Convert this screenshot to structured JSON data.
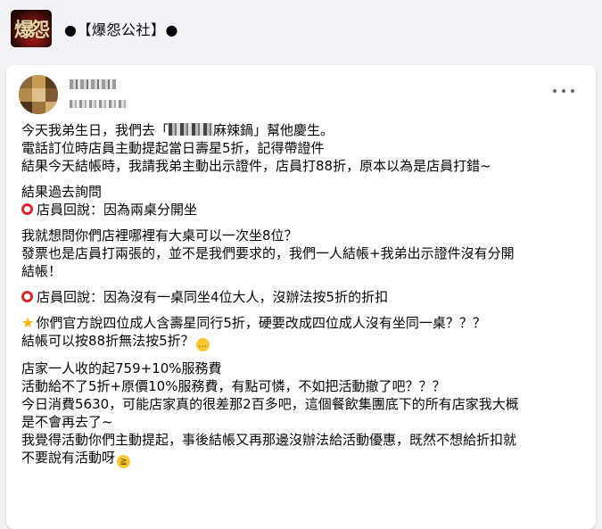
{
  "group": {
    "name": "●【爆怨公社】●",
    "logo_glyph": "爆怨"
  },
  "post": {
    "paragraphs": [
      {
        "lines": [
          {
            "segments": [
              {
                "type": "text",
                "value": "今天我弟生日，我們去「"
              },
              {
                "type": "censor"
              },
              {
                "type": "text",
                "value": "麻辣鍋」幫他慶生。"
              }
            ]
          },
          {
            "segments": [
              {
                "type": "text",
                "value": "電話訂位時店員主動提起當日壽星5折，記得帶證件"
              }
            ]
          },
          {
            "segments": [
              {
                "type": "text",
                "value": "結果今天結帳時，我請我弟主動出示證件，店員打88折，原本以為是店員打錯~"
              }
            ]
          }
        ]
      },
      {
        "lines": [
          {
            "segments": [
              {
                "type": "text",
                "value": "結果過去詢問"
              }
            ]
          },
          {
            "segments": [
              {
                "type": "icon",
                "value": "red-circle-icon"
              },
              {
                "type": "text",
                "value": "店員回說：因為兩桌分開坐"
              }
            ]
          }
        ]
      },
      {
        "lines": [
          {
            "segments": [
              {
                "type": "text",
                "value": "我就想問你們店裡哪裡有大桌可以一次坐8位？"
              }
            ]
          },
          {
            "segments": [
              {
                "type": "text",
                "value": "發票也是店員打兩張的，並不是我們要求的，我們一人結帳+我弟出示證件沒有分開"
              }
            ]
          },
          {
            "segments": [
              {
                "type": "text",
                "value": "結帳！"
              }
            ]
          }
        ]
      },
      {
        "lines": [
          {
            "segments": [
              {
                "type": "icon",
                "value": "red-circle-icon"
              },
              {
                "type": "text",
                "value": "店員回說：因為沒有一桌同坐4位大人，沒辦法按5折的折扣"
              }
            ]
          }
        ]
      },
      {
        "lines": [
          {
            "segments": [
              {
                "type": "icon",
                "value": "star-icon"
              },
              {
                "type": "text",
                "value": "你們官方說四位成人含壽星同行5折，硬要改成四位成人沒有坐同一桌？？？"
              }
            ]
          },
          {
            "segments": [
              {
                "type": "text",
                "value": "結帳可以按88折無法按5折？"
              },
              {
                "type": "icon",
                "value": "thinking-face-icon"
              }
            ]
          }
        ]
      },
      {
        "lines": [
          {
            "segments": [
              {
                "type": "text",
                "value": "店家一人收的起759+10%服務費"
              }
            ]
          },
          {
            "segments": [
              {
                "type": "text",
                "value": "活動給不了5折+原價10%服務費，有點可憐，不如把活動撤了吧？？？"
              }
            ]
          },
          {
            "segments": [
              {
                "type": "text",
                "value": "今日消費5630，可能店家真的很差那2百多吧，這個餐飲集團底下的所有店家我大概"
              }
            ]
          },
          {
            "segments": [
              {
                "type": "text",
                "value": "是不會再去了~"
              }
            ]
          },
          {
            "segments": [
              {
                "type": "text",
                "value": "我覺得活動你們主動提起，事後結帳又再那邊沒辦法給活動優惠，既然不想給折扣就"
              }
            ]
          },
          {
            "segments": [
              {
                "type": "text",
                "value": "不要說有活動呀"
              },
              {
                "type": "icon",
                "value": "laughing-face-icon"
              }
            ]
          }
        ]
      }
    ]
  }
}
